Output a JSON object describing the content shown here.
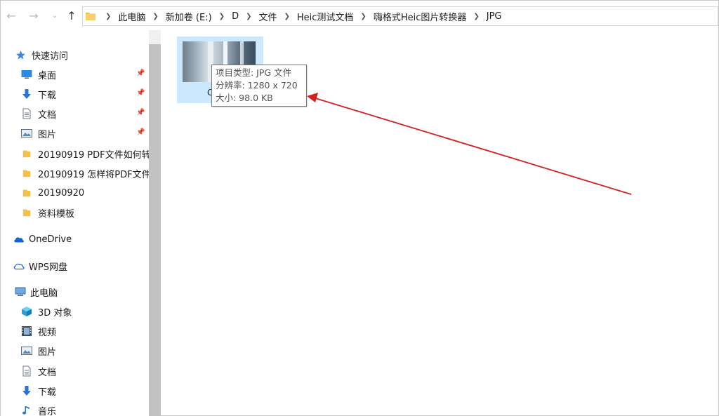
{
  "breadcrumb": [
    "此电脑",
    "新加卷 (E:)",
    "D",
    "文件",
    "Heic测试文档",
    "嗨格式Heic图片转换器",
    "JPG"
  ],
  "sidebar": {
    "quick_access": "快速访问",
    "quick_items": [
      {
        "label": "桌面",
        "icon": "desktop-icon",
        "pinned": true
      },
      {
        "label": "下载",
        "icon": "download-icon",
        "pinned": true
      },
      {
        "label": "文档",
        "icon": "document-icon",
        "pinned": true
      },
      {
        "label": "图片",
        "icon": "picture-icon",
        "pinned": true
      },
      {
        "label": "20190919 PDF文件如何转",
        "icon": "folder-icon",
        "pinned": false
      },
      {
        "label": "20190919 怎样将PDF文件",
        "icon": "folder-icon",
        "pinned": false
      },
      {
        "label": "20190920",
        "icon": "folder-icon",
        "pinned": false
      },
      {
        "label": "资料模板",
        "icon": "folder-icon",
        "pinned": false
      }
    ],
    "onedrive": "OneDrive",
    "wps": "WPS网盘",
    "this_pc": "此电脑",
    "pc_items": [
      {
        "label": "3D 对象",
        "icon": "cube-icon"
      },
      {
        "label": "视频",
        "icon": "video-icon"
      },
      {
        "label": "图片",
        "icon": "picture-icon"
      },
      {
        "label": "文档",
        "icon": "document-icon"
      },
      {
        "label": "下载",
        "icon": "download-icon"
      },
      {
        "label": "音乐",
        "icon": "music-icon"
      }
    ]
  },
  "file": {
    "name_visible": "C"
  },
  "tooltip": {
    "type": "项目类型: JPG 文件",
    "resolution": "分辨率: 1280 x 720",
    "size": "大小: 98.0 KB"
  },
  "colors": {
    "selection": "#cce8ff",
    "arrow": "#d42020",
    "folder": "#f3c04a",
    "accent": "#1e6fd9"
  }
}
